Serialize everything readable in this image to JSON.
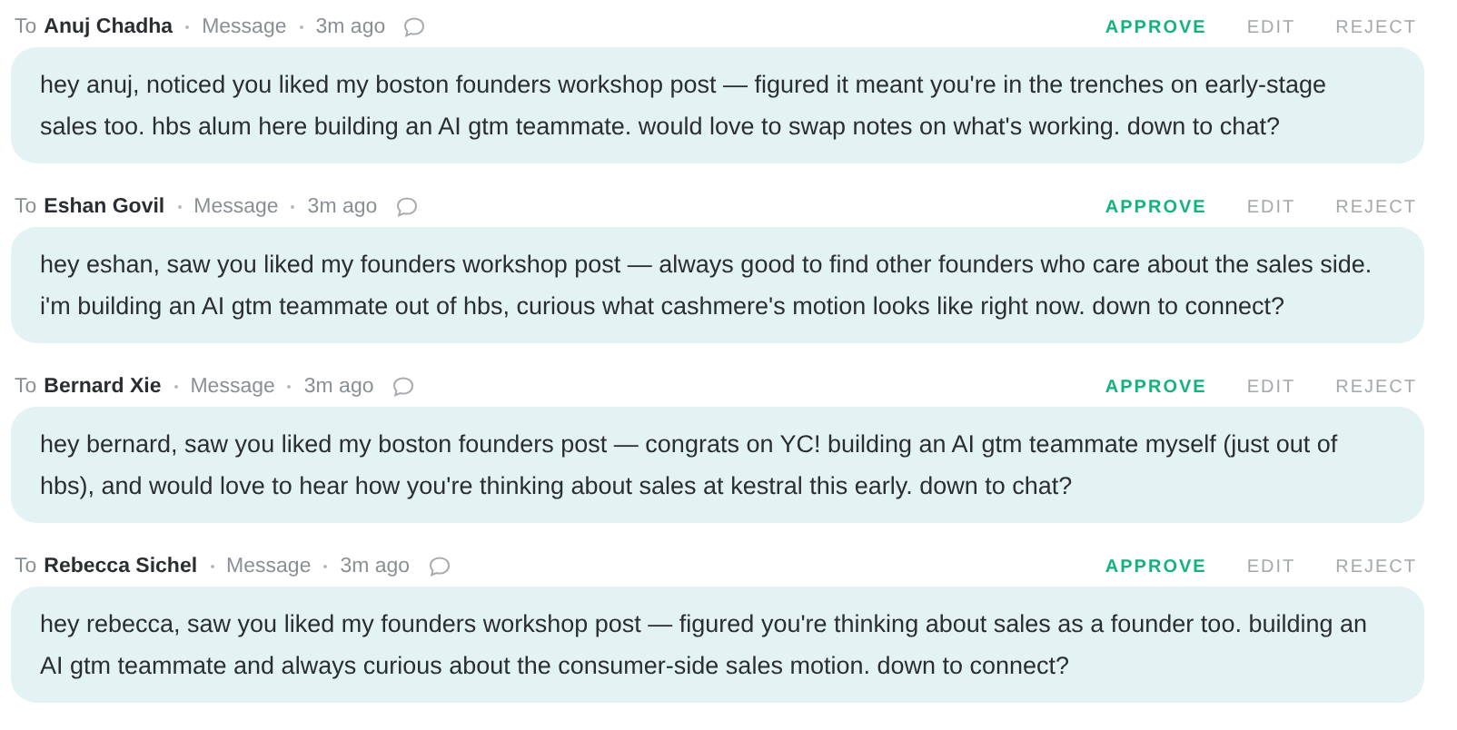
{
  "messages": [
    {
      "to_label": "To",
      "recipient": "Anuj Chadha",
      "type": "Message",
      "time": "3m ago",
      "actions": [
        "APPROVE",
        "EDIT",
        "REJECT"
      ],
      "body": "hey anuj, noticed you liked my boston founders workshop post — figured it meant you're in the trenches on early-stage sales too. hbs alum here building an AI gtm teammate. would love to swap notes on what's working. down to chat?"
    },
    {
      "to_label": "To",
      "recipient": "Eshan Govil",
      "type": "Message",
      "time": "3m ago",
      "actions": [
        "APPROVE",
        "EDIT",
        "REJECT"
      ],
      "body": "hey eshan, saw you liked my founders workshop post — always good to find other founders who care about the sales side. i'm building an AI gtm teammate out of hbs, curious what cashmere's motion looks like right now. down to connect?"
    },
    {
      "to_label": "To",
      "recipient": "Bernard Xie",
      "type": "Message",
      "time": "3m ago",
      "actions": [
        "APPROVE",
        "EDIT",
        "REJECT"
      ],
      "body": "hey bernard, saw you liked my boston founders post — congrats on YC! building an AI gtm teammate myself (just out of hbs), and would love to hear how you're thinking about sales at kestral this early. down to chat?"
    },
    {
      "to_label": "To",
      "recipient": "Rebecca Sichel",
      "type": "Message",
      "time": "3m ago",
      "actions": [
        "APPROVE",
        "EDIT",
        "REJECT"
      ],
      "body": "hey rebecca, saw you liked my founders workshop post — figured you're thinking about sales as a founder too. building an AI gtm teammate and always curious about the consumer-side sales motion. down to connect?"
    }
  ]
}
